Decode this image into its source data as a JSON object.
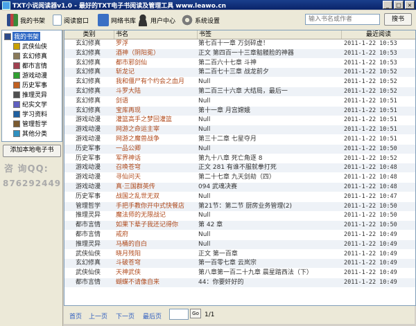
{
  "window": {
    "title": "TXT小说阅读器v1.0 - 最好的TXT电子书阅读及管理工具  www.leawo.cn",
    "controls": [
      "_",
      "□",
      "×"
    ]
  },
  "toolbar": {
    "items": [
      {
        "label": "我的书架",
        "icon": "bookshelf-icon",
        "color": "#2c4a8a"
      },
      {
        "label": "阅读窗口",
        "icon": "document-icon",
        "color": "#f5f5f5"
      },
      {
        "label": "网络书库",
        "icon": "library-icon",
        "color": "#3a6fc4"
      },
      {
        "label": "用户中心",
        "icon": "user-icon",
        "color": "#333333"
      },
      {
        "label": "系统设置",
        "icon": "gear-icon",
        "color": "#7a7a7a"
      }
    ],
    "search_placeholder": "输入书名或作者",
    "search_button": "搜书"
  },
  "sidebar": {
    "root": "我的书架",
    "categories": [
      {
        "label": "武侠仙侠",
        "color": "#c8a000"
      },
      {
        "label": "玄幻修真",
        "color": "#8a7a5a"
      },
      {
        "label": "都市言情",
        "color": "#a04050"
      },
      {
        "label": "游戏动漫",
        "color": "#30a030"
      },
      {
        "label": "历史军事",
        "color": "#c06020"
      },
      {
        "label": "推理灵异",
        "color": "#505050"
      },
      {
        "label": "纪实文学",
        "color": "#6060c0"
      },
      {
        "label": "学习资料",
        "color": "#2060a0"
      },
      {
        "label": "管理哲学",
        "color": "#7a5a30"
      },
      {
        "label": "其他分类",
        "color": "#3090c0"
      }
    ],
    "add_button": "添加本地电子书",
    "qq_label": "咨 询QQ:",
    "qq_number": "876292449"
  },
  "table": {
    "headers": [
      "类别",
      "书名",
      "书签",
      "最近阅读"
    ],
    "rows": [
      {
        "category": "玄幻修真",
        "title": "罗浮",
        "bookmark": "第七百十一章 万剑碎虚！",
        "time": "2011-1-22 10:53"
      },
      {
        "category": "玄幻修真",
        "title": "酒神（阴阳冕）",
        "bookmark": "正文 第四百一十三章骷髅脸的神器",
        "time": "2011-1-22 10:53"
      },
      {
        "category": "玄幻修真",
        "title": "都市邪剑仙",
        "bookmark": "第二百六十七章 斗神",
        "time": "2011-1-22 10:53"
      },
      {
        "category": "玄幻修真",
        "title": "斩龙记",
        "bookmark": "第二百七十三章 战龙前夕",
        "time": "2011-1-22 10:52"
      },
      {
        "category": "玄幻修真",
        "title": "我和僵尸有个约会之血月",
        "bookmark": "Null",
        "time": "2011-1-22 10:52"
      },
      {
        "category": "玄幻修真",
        "title": "斗罗大陆",
        "bookmark": "第二百三十六章 大结局，最后一",
        "time": "2011-1-22 10:52"
      },
      {
        "category": "玄幻修真",
        "title": "剑语",
        "bookmark": "Null",
        "time": "2011-1-22 10:51"
      },
      {
        "category": "玄幻修真",
        "title": "宝库再现",
        "bookmark": "第十一章 月宫嫦娥",
        "time": "2011-1-22 10:51"
      },
      {
        "category": "游戏动漫",
        "title": "灌篮高手之梦回灌篮",
        "bookmark": "Null",
        "time": "2011-1-22 10:51"
      },
      {
        "category": "游戏动漫",
        "title": "网游之命运主宰",
        "bookmark": "Null",
        "time": "2011-1-22 10:51"
      },
      {
        "category": "游戏动漫",
        "title": "网游之魔兽战争",
        "bookmark": "第三十二章 七星夺月",
        "time": "2011-1-22 10:51"
      },
      {
        "category": "历史军事",
        "title": "一品公卿",
        "bookmark": "Null",
        "time": "2011-1-22 10:50"
      },
      {
        "category": "历史军事",
        "title": "军界神话",
        "bookmark": "第九十八章 死亡角逐 8",
        "time": "2011-1-22 10:52"
      },
      {
        "category": "游戏动漫",
        "title": "召唤苍穹",
        "bookmark": "正文 281 有谁不服就拳打死",
        "time": "2011-1-22 10:48"
      },
      {
        "category": "游戏动漫",
        "title": "寻仙问天",
        "bookmark": "第二十七章 九天剑劫（四）",
        "time": "2011-1-22 10:48"
      },
      {
        "category": "游戏动漫",
        "title": "真·三国群英传",
        "bookmark": "094 武魂决赛",
        "time": "2011-1-22 10:48"
      },
      {
        "category": "历史军事",
        "title": "战国之乱世无双",
        "bookmark": "Null",
        "time": "2011-1-22 10:47"
      },
      {
        "category": "管理哲学",
        "title": "手把手教你开中式快餐店",
        "bookmark": "第21节：第二节  厨房业务管理(2)",
        "time": "2011-1-22 10:50"
      },
      {
        "category": "推理灵异",
        "title": "魔法师的无限战记",
        "bookmark": "Null",
        "time": "2011-1-22 10:50"
      },
      {
        "category": "都市言情",
        "title": "如果下辈子我还记得你",
        "bookmark": "第 42 章",
        "time": "2011-1-22 10:50"
      },
      {
        "category": "都市言情",
        "title": "戒府",
        "bookmark": "Null",
        "time": "2011-1-22 10:49"
      },
      {
        "category": "推理灵异",
        "title": "马桶的自白",
        "bookmark": "Null",
        "time": "2011-1-22 10:49"
      },
      {
        "category": "武侠仙侠",
        "title": "晓月残阳",
        "bookmark": "正文 第一百章",
        "time": "2011-1-22 10:49"
      },
      {
        "category": "玄幻修真",
        "title": "斗破苍穹",
        "bookmark": "第一百零七章 云岚宗",
        "time": "2011-1-22 10:49"
      },
      {
        "category": "武侠仙侠",
        "title": "天神武侠",
        "bookmark": "第八章第一百二十九章 晨星踏西法（下）",
        "time": "2011-1-22 10:49"
      },
      {
        "category": "都市言情",
        "title": "蝴蝶不请像自来",
        "bookmark": "44：你要奸好的",
        "time": "2011-1-22 10:49"
      }
    ]
  },
  "footer": {
    "first": "首页",
    "prev": "上一页",
    "next": "下一页",
    "last": "最后页",
    "go": "Go",
    "page_total": "1/1"
  }
}
